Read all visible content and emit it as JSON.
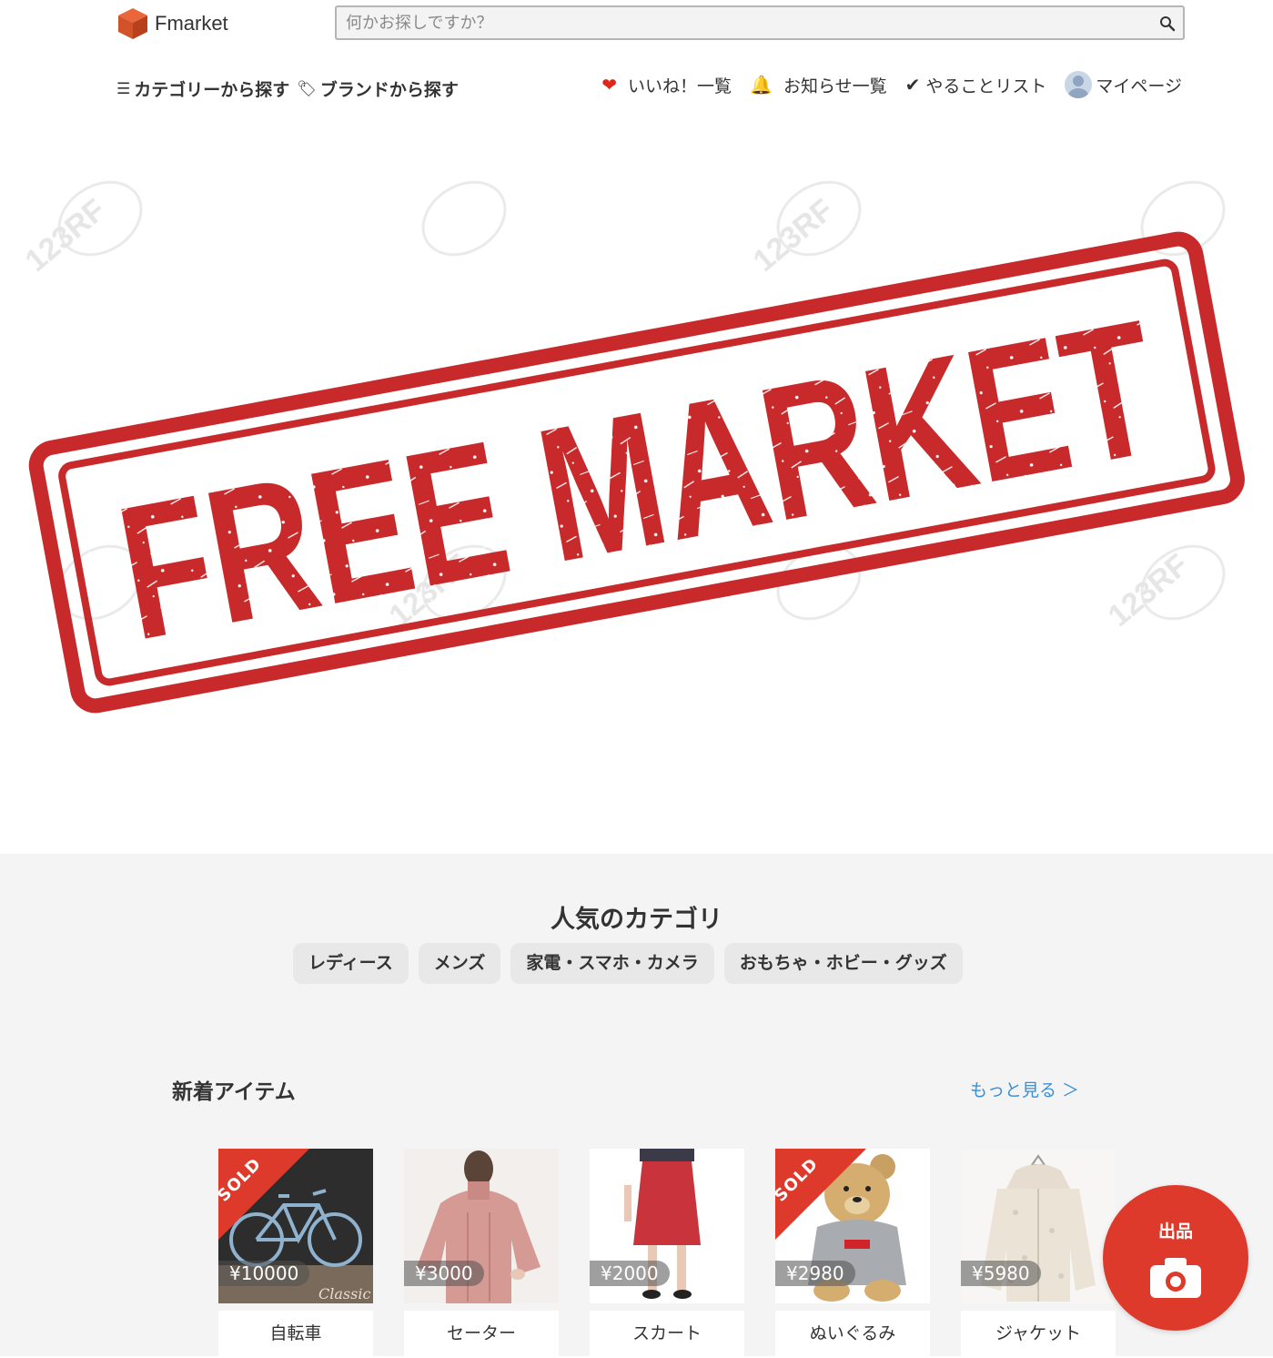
{
  "header": {
    "logo_text": "Fmarket",
    "search_placeholder": "何かお探しですか？"
  },
  "nav_left": [
    {
      "label": "カテゴリーから探す",
      "icon": "list-icon"
    },
    {
      "label": "ブランドから探す",
      "icon": "tag-icon"
    }
  ],
  "nav_right": [
    {
      "label": "いいね！一覧",
      "icon": "heart-icon"
    },
    {
      "label": "お知らせ一覧",
      "icon": "bell-icon"
    },
    {
      "label": "やることリスト",
      "icon": "check-icon"
    },
    {
      "label": "マイページ",
      "icon": "avatar-icon"
    }
  ],
  "hero": {
    "stamp_text": "FREE MARKET",
    "watermark_text": "123RF",
    "stamp_color": "#c8292a"
  },
  "popular": {
    "title": "人気のカテゴリ",
    "chips": [
      "レディース",
      "メンズ",
      "家電・スマホ・カメラ",
      "おもちゃ・ホビー・グッズ"
    ]
  },
  "new_items": {
    "title": "新着アイテム",
    "more_label": "もっと見る ＞",
    "items": [
      {
        "name": "自転車",
        "price": "¥10000",
        "sold": true,
        "sold_label": "SOLD",
        "thumb_caption": "Classic"
      },
      {
        "name": "セーター",
        "price": "¥3000",
        "sold": false
      },
      {
        "name": "スカート",
        "price": "¥2000",
        "sold": false
      },
      {
        "name": "ぬいぐるみ",
        "price": "¥2980",
        "sold": true,
        "sold_label": "SOLD"
      },
      {
        "name": "ジャケット",
        "price": "¥5980",
        "sold": false
      }
    ]
  },
  "fab": {
    "label": "出品",
    "icon": "camera-icon"
  },
  "colors": {
    "accent": "#dd3a2c",
    "link": "#3b8fd6",
    "background_gray": "#f4f4f4"
  }
}
